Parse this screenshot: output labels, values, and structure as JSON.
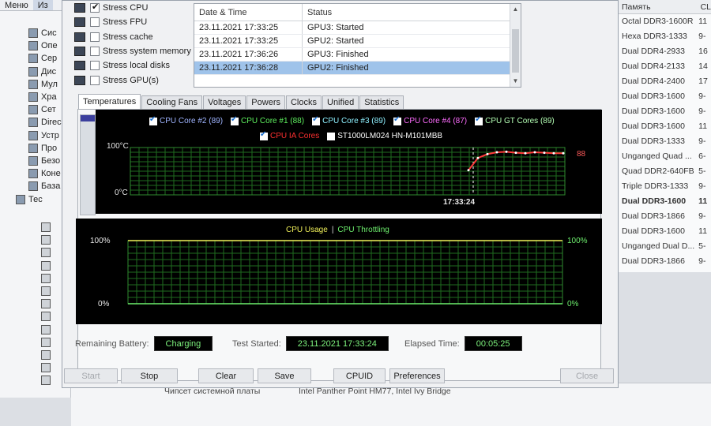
{
  "background_app": {
    "menu": [
      "Меню",
      "Из"
    ],
    "tree_items": [
      {
        "label": "Сис"
      },
      {
        "label": "Опе"
      },
      {
        "label": "Сер"
      },
      {
        "label": "Дис"
      },
      {
        "label": "Мул"
      },
      {
        "label": "Хра"
      },
      {
        "label": "Сет"
      },
      {
        "label": "Direc"
      },
      {
        "label": "Устр"
      },
      {
        "label": "Про"
      },
      {
        "label": "Безо"
      },
      {
        "label": "Коне"
      },
      {
        "label": "База"
      },
      {
        "label": "Тес"
      }
    ],
    "right_table": {
      "headers": [
        "Память",
        "CL"
      ],
      "rows": [
        [
          "Octal DDR3-1600R",
          "11"
        ],
        [
          "Hexa DDR3-1333",
          "9-"
        ],
        [
          "Dual DDR4-2933",
          "16"
        ],
        [
          "Dual DDR4-2133",
          "14"
        ],
        [
          "Dual DDR4-2400",
          "17"
        ],
        [
          "Dual DDR3-1600",
          "9-"
        ],
        [
          "Dual DDR3-1600",
          "9-"
        ],
        [
          "Dual DDR3-1600",
          "11"
        ],
        [
          "Dual DDR3-1333",
          "9-"
        ],
        [
          "Unganged Quad ...",
          "6-"
        ],
        [
          "Quad DDR2-640FB",
          "5-"
        ],
        [
          "Triple DDR3-1333",
          "9-"
        ],
        [
          "Dual DDR3-1600",
          "11"
        ],
        [
          "Dual DDR3-1866",
          "9-"
        ],
        [
          "Dual DDR3-1600",
          "11"
        ],
        [
          "Unganged Dual D...",
          "5-"
        ],
        [
          "Dual DDR3-1866",
          "9-"
        ]
      ],
      "bold_row_index": 12
    },
    "bottom_row": {
      "label": "Чипсет системной платы",
      "value": "Intel Panther Point HM77, Intel Ivy Bridge"
    }
  },
  "stress_options": [
    {
      "label": "Stress CPU",
      "checked": true,
      "icon": "cpu-icon"
    },
    {
      "label": "Stress FPU",
      "checked": false,
      "icon": "fpu-icon"
    },
    {
      "label": "Stress cache",
      "checked": false,
      "icon": "cache-icon"
    },
    {
      "label": "Stress system memory",
      "checked": false,
      "icon": "memory-icon"
    },
    {
      "label": "Stress local disks",
      "checked": false,
      "icon": "disk-icon"
    },
    {
      "label": "Stress GPU(s)",
      "checked": false,
      "icon": "monitor-icon"
    }
  ],
  "log": {
    "headers": [
      "Date & Time",
      "Status"
    ],
    "rows": [
      {
        "datetime": "23.11.2021 17:33:25",
        "status": "GPU3: Started",
        "selected": false
      },
      {
        "datetime": "23.11.2021 17:33:25",
        "status": "GPU2: Started",
        "selected": false
      },
      {
        "datetime": "23.11.2021 17:36:26",
        "status": "GPU3: Finished",
        "selected": false
      },
      {
        "datetime": "23.11.2021 17:36:28",
        "status": "GPU2: Finished",
        "selected": true
      }
    ]
  },
  "tabs": [
    "Temperatures",
    "Cooling Fans",
    "Voltages",
    "Powers",
    "Clocks",
    "Unified",
    "Statistics"
  ],
  "active_tab": "Temperatures",
  "temp_graph": {
    "legend_row1": [
      {
        "label": "CPU Core #2 (89)",
        "color": "#9fb4ff",
        "checked": true
      },
      {
        "label": "CPU Core #1 (88)",
        "color": "#5ef05e",
        "checked": true
      },
      {
        "label": "CPU Core #3 (89)",
        "color": "#8ef0ff",
        "checked": true
      },
      {
        "label": "CPU Core #4 (87)",
        "color": "#ff6cff",
        "checked": true
      },
      {
        "label": "CPU GT Cores (89)",
        "color": "#b4ffb4",
        "checked": true
      }
    ],
    "legend_row2": [
      {
        "label": "CPU IA Cores",
        "color": "#ff3030",
        "checked": true
      },
      {
        "label": "ST1000LM024 HN-M101MBB",
        "color": "#ffffff",
        "checked": false
      }
    ],
    "y_top": "100°C",
    "y_bottom": "0°C",
    "time_marker": "17:33:24",
    "current_value": "88"
  },
  "chart_data": {
    "type": "line",
    "title": "",
    "xlabel": "",
    "ylabel": "",
    "ylim": [
      0,
      100
    ],
    "x": [
      "17:33:24",
      "+",
      "+",
      "+",
      "+",
      "+",
      "+",
      "+",
      "+",
      "+",
      "+"
    ],
    "series": [
      {
        "name": "CPU IA Cores",
        "values": [
          52,
          78,
          86,
          90,
          91,
          89,
          88,
          90,
          89,
          88,
          88
        ]
      }
    ],
    "grid": true
  },
  "usage_graph": {
    "title_usage": "CPU Usage",
    "title_sep": "|",
    "title_throttling": "CPU Throttling",
    "y_top_left": "100%",
    "y_bottom_left": "0%",
    "y_top_right": "100%",
    "y_bottom_right": "0%",
    "usage_color": "#f2f25a",
    "throttling_color": "#6ef06e"
  },
  "status": {
    "battery_label": "Remaining Battery:",
    "battery_value": "Charging",
    "started_label": "Test Started:",
    "started_value": "23.11.2021 17:33:24",
    "elapsed_label": "Elapsed Time:",
    "elapsed_value": "00:05:25"
  },
  "buttons": {
    "start": "Start",
    "stop": "Stop",
    "clear": "Clear",
    "save": "Save",
    "cpuid": "CPUID",
    "preferences": "Preferences",
    "close": "Close"
  }
}
